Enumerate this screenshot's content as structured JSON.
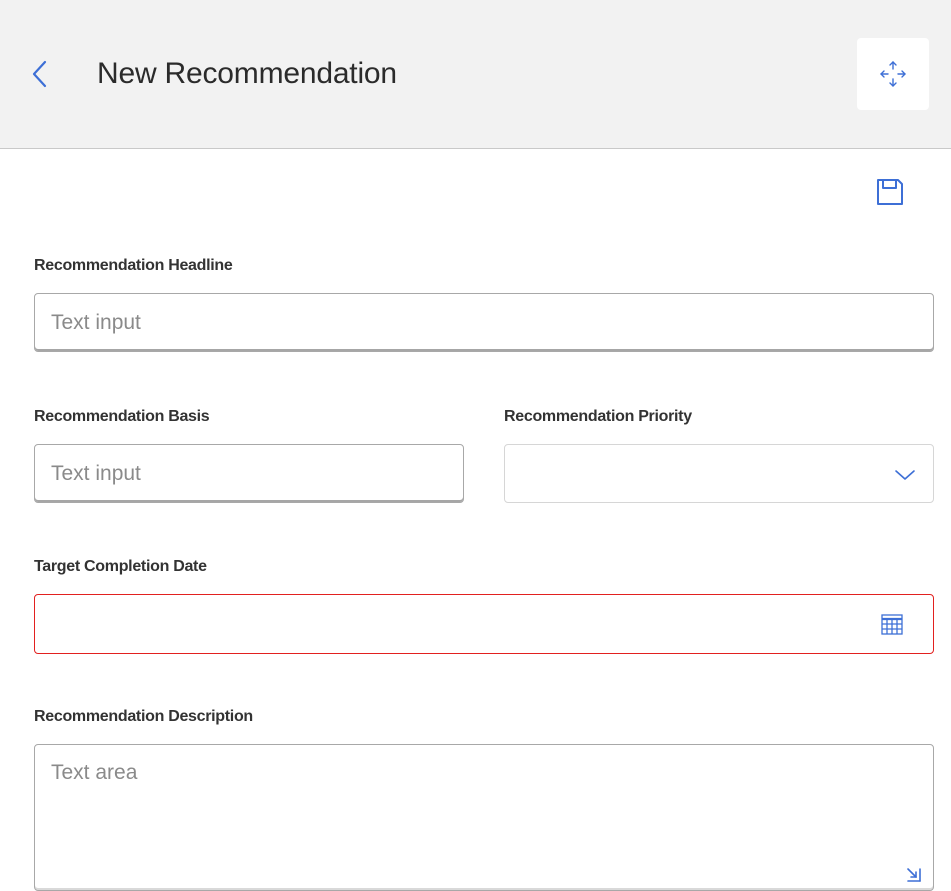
{
  "header": {
    "title": "New Recommendation",
    "back_icon": "chevron-left-icon",
    "expand_icon": "move-arrows-icon",
    "background": "#f2f2f2"
  },
  "toolbar": {
    "save_icon": "floppy-disk-icon",
    "accent": "#3d6fd6"
  },
  "form": {
    "headline": {
      "label": "Recommendation Headline",
      "value": "",
      "placeholder": "Text input"
    },
    "basis": {
      "label": "Recommendation Basis",
      "value": "",
      "placeholder": "Text input"
    },
    "priority": {
      "label": "Recommendation Priority",
      "selected": "",
      "icon": "chevron-down-icon"
    },
    "target_date": {
      "label": "Target Completion Date",
      "value": "",
      "icon": "calendar-icon",
      "error_color": "#e2201f"
    },
    "description": {
      "label": "Recommendation Description",
      "value": "",
      "placeholder": "Text area",
      "resize_icon": "resize-handle-icon"
    }
  }
}
